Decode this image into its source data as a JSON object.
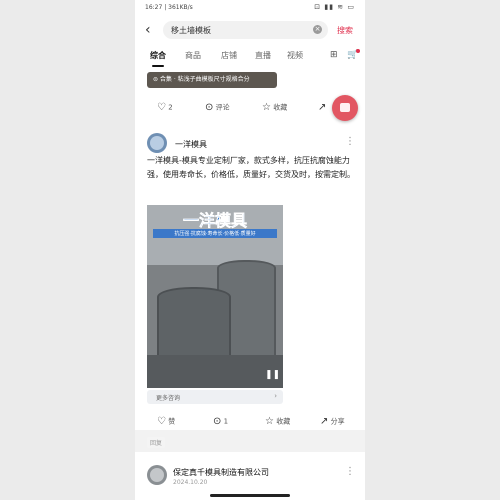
{
  "status_bar": {
    "time": "16:27 | 361KB/s",
    "icons": "⊡ ▮▮ ≋ ▭"
  },
  "search": {
    "back_icon": "‹",
    "query": "移土墙模板",
    "clear_icon": "×",
    "button": "搜索"
  },
  "tabs": [
    {
      "label": "综合",
      "active": true
    },
    {
      "label": "商品",
      "active": false
    },
    {
      "label": "店铺",
      "active": false
    },
    {
      "label": "直播",
      "active": false
    },
    {
      "label": "视频",
      "active": false
    }
  ],
  "toolbar": {
    "filter_icon": "⊞",
    "cart_icon": "🛒"
  },
  "top_card": {
    "banner": "⊜ 合集 · 粘浅子曲模板尺寸规格合分",
    "actions": {
      "like": "2",
      "comment": "评论",
      "collect": "收藏",
      "share": ""
    }
  },
  "post": {
    "author": "一洋模具",
    "body": "一洋模具-模具专业定制厂家，款式多样，抗压抗腐蚀能力强，使用寿命长，价格低，质量好，交货及时，按需定制。",
    "video": {
      "title": "一洋模具",
      "subtitle": "抗压强·抗腐蚀·寿命长·价格低·质量好"
    },
    "link_pill": "更多咨询",
    "actions": {
      "like": "赞",
      "comment": "1",
      "collect": "收藏",
      "share": "分享"
    },
    "tag": "回复"
  },
  "next_post": {
    "author": "保定真千模具制造有限公司",
    "date": "2024.10.20"
  }
}
